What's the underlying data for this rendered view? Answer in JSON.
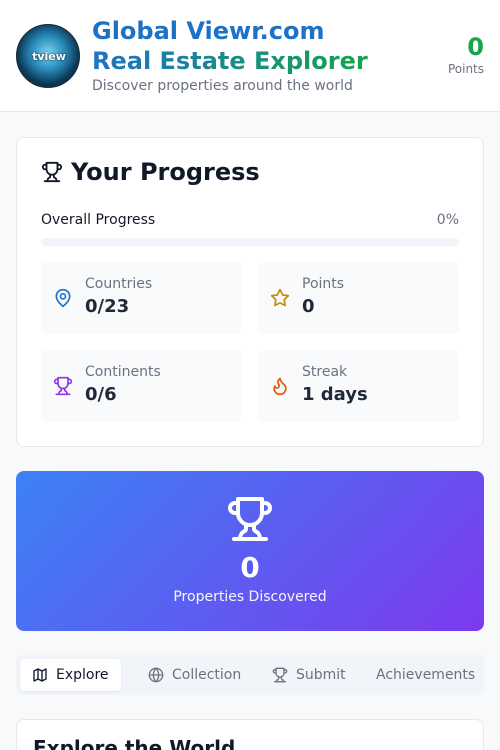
{
  "header": {
    "logo_text": "tview",
    "title_line1": "Global Viewr.com",
    "title_line2": "Real Estate Explorer",
    "subtitle": "Discover properties around the world",
    "points_value": "0",
    "points_label": "Points"
  },
  "progress": {
    "title": "Your Progress",
    "overall_label": "Overall Progress",
    "overall_percent": "0%",
    "overall_fraction": 0,
    "stats": [
      {
        "label": "Countries",
        "value": "0/23",
        "icon": "map-pin-icon"
      },
      {
        "label": "Points",
        "value": "0",
        "icon": "star-icon"
      },
      {
        "label": "Continents",
        "value": "0/6",
        "icon": "trophy-icon"
      },
      {
        "label": "Streak",
        "value": "1 days",
        "icon": "flame-icon"
      }
    ]
  },
  "banner": {
    "count": "0",
    "caption": "Properties Discovered"
  },
  "tabs": [
    {
      "label": "Explore",
      "icon": "map-icon",
      "active": true
    },
    {
      "label": "Collection",
      "icon": "globe-icon",
      "active": false
    },
    {
      "label": "Submit",
      "icon": "trophy-icon",
      "active": false
    },
    {
      "label": "Achievements",
      "icon": "",
      "active": false
    }
  ],
  "explore": {
    "title": "Explore the World"
  },
  "colors": {
    "blue": "#1d72c8",
    "green": "#16a34a",
    "purple": "#9333ea",
    "orange": "#ea580c"
  }
}
